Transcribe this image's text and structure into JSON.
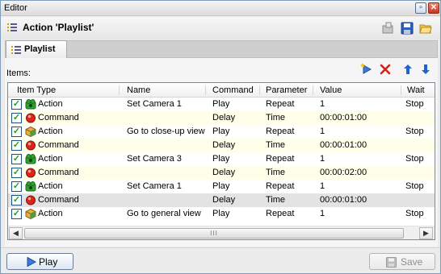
{
  "window": {
    "title": "Editor",
    "restore_glyph": "▫",
    "close_glyph": "✕"
  },
  "header": {
    "title": "Action 'Playlist'",
    "icon": "list-icon",
    "toolbar": [
      "export-icon",
      "save-disk-icon",
      "open-folder-icon"
    ]
  },
  "tabs": [
    {
      "label": "Playlist",
      "icon": "list-icon",
      "active": true
    }
  ],
  "items_label": "Items:",
  "list_actions": [
    "add-item-icon",
    "delete-icon",
    "move-up-icon",
    "move-down-icon"
  ],
  "columns": [
    "Item Type",
    "Name",
    "Command",
    "Parameter",
    "Value",
    "Wait"
  ],
  "rows": [
    {
      "checked": true,
      "icon": "camera-action-icon",
      "type": "Action",
      "name": "Set Camera 1",
      "command": "Play",
      "parameter": "Repeat",
      "value": "1",
      "wait": "Stop",
      "style": ""
    },
    {
      "checked": true,
      "icon": "command-delay-icon",
      "type": "Command",
      "name": "",
      "command": "Delay",
      "parameter": "Time",
      "value": "00:00:01:00",
      "wait": "",
      "style": "alt"
    },
    {
      "checked": true,
      "icon": "cube-action-icon",
      "type": "Action",
      "name": "Go to close-up view",
      "command": "Play",
      "parameter": "Repeat",
      "value": "1",
      "wait": "Stop",
      "style": ""
    },
    {
      "checked": true,
      "icon": "command-delay-icon",
      "type": "Command",
      "name": "",
      "command": "Delay",
      "parameter": "Time",
      "value": "00:00:01:00",
      "wait": "",
      "style": "alt"
    },
    {
      "checked": true,
      "icon": "camera-action-icon",
      "type": "Action",
      "name": "Set Camera 3",
      "command": "Play",
      "parameter": "Repeat",
      "value": "1",
      "wait": "Stop",
      "style": ""
    },
    {
      "checked": true,
      "icon": "command-delay-icon",
      "type": "Command",
      "name": "",
      "command": "Delay",
      "parameter": "Time",
      "value": "00:00:02:00",
      "wait": "",
      "style": "alt"
    },
    {
      "checked": true,
      "icon": "camera-action-icon",
      "type": "Action",
      "name": "Set Camera 1",
      "command": "Play",
      "parameter": "Repeat",
      "value": "1",
      "wait": "Stop",
      "style": ""
    },
    {
      "checked": true,
      "icon": "command-delay-icon",
      "type": "Command",
      "name": "",
      "command": "Delay",
      "parameter": "Time",
      "value": "00:00:01:00",
      "wait": "",
      "style": "sel"
    },
    {
      "checked": true,
      "icon": "cube-action-icon",
      "type": "Action",
      "name": "Go to general view",
      "command": "Play",
      "parameter": "Repeat",
      "value": "1",
      "wait": "Stop",
      "style": ""
    }
  ],
  "scrollbar": {
    "left_glyph": "◀",
    "right_glyph": "▶",
    "grip": "III"
  },
  "buttons": {
    "play": "Play",
    "save": "Save",
    "save_enabled": false
  },
  "colors": {
    "accent_blue": "#1f64c8",
    "delete_red": "#d4201c",
    "camera_green": "#2fa12f"
  }
}
